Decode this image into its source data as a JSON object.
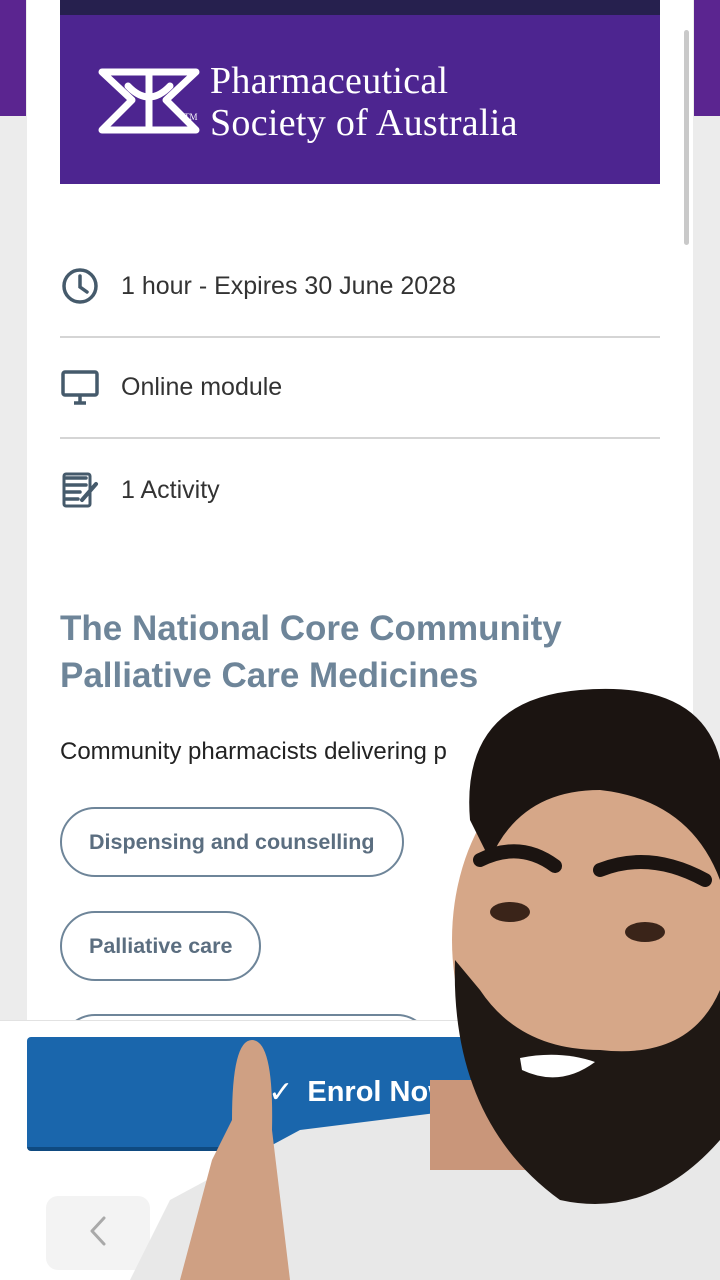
{
  "brand": {
    "name_line1": "Pharmaceutical",
    "name_line2": "Society of Australia",
    "tm": "TM",
    "banner_color": "#4d2590"
  },
  "info": {
    "duration": "1 hour - Expires 30 June 2028",
    "format": "Online module",
    "activities": "1 Activity"
  },
  "course": {
    "title": "The National Core Community Palliative Care Medicines",
    "description": "Community pharmacists delivering p"
  },
  "tags": [
    "Dispensing and counselling",
    "Palliative care"
  ],
  "actions": {
    "enrol_label": "Enrol Now",
    "enrol_color": "#1a66ac"
  },
  "icons": {
    "duration": "clock-icon",
    "format": "monitor-icon",
    "activities": "activity-list-icon",
    "enrol": "check-icon",
    "back": "chevron-left-icon"
  }
}
